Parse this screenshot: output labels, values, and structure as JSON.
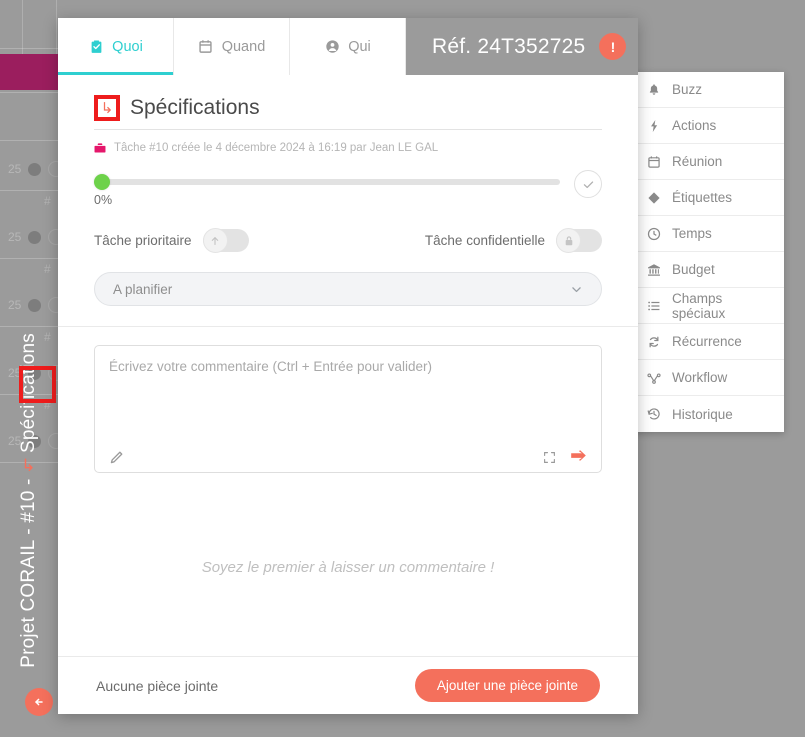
{
  "background": {
    "vertical_title": "Projet CORAIL - #10 -   Spécifications",
    "arrow_icon": "subtask-arrow-icon",
    "back_button_icon": "arrow-left-icon",
    "rows": [
      {
        "count": "25",
        "hash": "#"
      },
      {
        "count": "25",
        "hash": "#"
      },
      {
        "count": "25",
        "hash": "#"
      },
      {
        "count": "25",
        "hash": "#"
      }
    ]
  },
  "tabs": [
    {
      "label": "Quoi",
      "icon": "clipboard-check-icon",
      "active": true
    },
    {
      "label": "Quand",
      "icon": "calendar-icon",
      "active": false
    },
    {
      "label": "Qui",
      "icon": "user-circle-icon",
      "active": false
    }
  ],
  "header": {
    "reference": "Réf. 24T352725",
    "alert_label": "!",
    "alert_icon": "exclamation-icon"
  },
  "task": {
    "title": "Spécifications",
    "title_arrow_icon": "subtask-arrow-icon",
    "meta_icon": "briefcase-icon",
    "meta": "Tâche #10 créée le 4 décembre 2024 à 16:19 par Jean LE GAL",
    "progress_percent": "0%",
    "progress_value": 0,
    "validate_icon": "check-icon"
  },
  "toggles": [
    {
      "label": "Tâche prioritaire",
      "icon": "arrow-up-icon",
      "state": "off"
    },
    {
      "label": "Tâche confidentielle",
      "icon": "lock-icon",
      "state": "off"
    }
  ],
  "status_select": {
    "value": "A planifier",
    "chevron_icon": "chevron-down-icon"
  },
  "comment": {
    "placeholder": "Écrivez votre commentaire (Ctrl + Entrée pour valider)",
    "value": "",
    "edit_icon": "pencil-icon",
    "expand_icon": "expand-icon",
    "send_icon": "send-arrow-icon",
    "empty_message": "Soyez le premier à laisser un commentaire !"
  },
  "menu": [
    {
      "label": "Buzz",
      "icon": "bell-icon"
    },
    {
      "label": "Actions",
      "icon": "bolt-icon"
    },
    {
      "label": "Réunion",
      "icon": "calendar-icon"
    },
    {
      "label": "Étiquettes",
      "icon": "tag-icon"
    },
    {
      "label": "Temps",
      "icon": "clock-icon"
    },
    {
      "label": "Budget",
      "icon": "bank-icon"
    },
    {
      "label": "Champs spéciaux",
      "icon": "list-icon"
    },
    {
      "label": "Récurrence",
      "icon": "refresh-icon"
    },
    {
      "label": "Workflow",
      "icon": "workflow-icon"
    },
    {
      "label": "Historique",
      "icon": "history-icon"
    }
  ],
  "footer": {
    "attachment_text": "Aucune pièce jointe",
    "add_attachment_label": "Ajouter une pièce jointe"
  },
  "colors": {
    "accent_cyan": "#2ecfd0",
    "coral": "#f4705c",
    "magenta": "#9b1e5e",
    "green": "#6dd24a",
    "highlight_red": "#ee1c1c",
    "backdrop_gray": "#9b9b9b"
  }
}
